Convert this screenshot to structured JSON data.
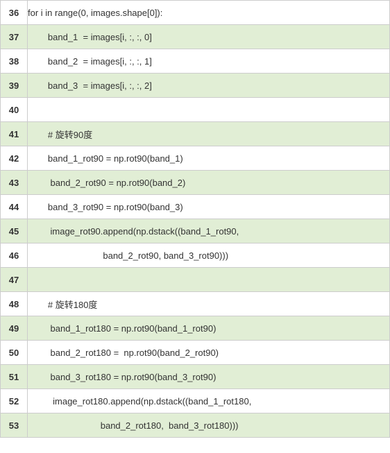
{
  "rows": [
    {
      "num": "36",
      "code": "for i in range(0, images.shape[0]):",
      "even": false,
      "indent": 0
    },
    {
      "num": "37",
      "code": "band_1  = images[i, :, :, 0]",
      "even": true,
      "indent": 1
    },
    {
      "num": "38",
      "code": "band_2  = images[i, :, :, 1]",
      "even": false,
      "indent": 1
    },
    {
      "num": "39",
      "code": "band_3  = images[i, :, :, 2]",
      "even": true,
      "indent": 1
    },
    {
      "num": "40",
      "code": "",
      "even": false,
      "indent": 0
    },
    {
      "num": "41",
      "code": "# 旋转90度",
      "even": true,
      "indent": 1
    },
    {
      "num": "42",
      "code": "band_1_rot90 = np.rot90(band_1)",
      "even": false,
      "indent": 1
    },
    {
      "num": "43",
      "code": " band_2_rot90 = np.rot90(band_2)",
      "even": true,
      "indent": 1
    },
    {
      "num": "44",
      "code": "band_3_rot90 = np.rot90(band_3)",
      "even": false,
      "indent": 1
    },
    {
      "num": "45",
      "code": " image_rot90.append(np.dstack((band_1_rot90,",
      "even": true,
      "indent": 1
    },
    {
      "num": "46",
      "code": "                      band_2_rot90, band_3_rot90)))",
      "even": false,
      "indent": 1
    },
    {
      "num": "47",
      "code": "",
      "even": true,
      "indent": 0
    },
    {
      "num": "48",
      "code": "# 旋转180度",
      "even": false,
      "indent": 1
    },
    {
      "num": "49",
      "code": " band_1_rot180 = np.rot90(band_1_rot90)",
      "even": true,
      "indent": 1
    },
    {
      "num": "50",
      "code": " band_2_rot180 =  np.rot90(band_2_rot90)",
      "even": false,
      "indent": 1
    },
    {
      "num": "51",
      "code": " band_3_rot180 = np.rot90(band_3_rot90)",
      "even": true,
      "indent": 1
    },
    {
      "num": "52",
      "code": "  image_rot180.append(np.dstack((band_1_rot180,",
      "even": false,
      "indent": 1
    },
    {
      "num": "53",
      "code": "                     band_2_rot180,  band_3_rot180)))",
      "even": true,
      "indent": 1
    }
  ]
}
